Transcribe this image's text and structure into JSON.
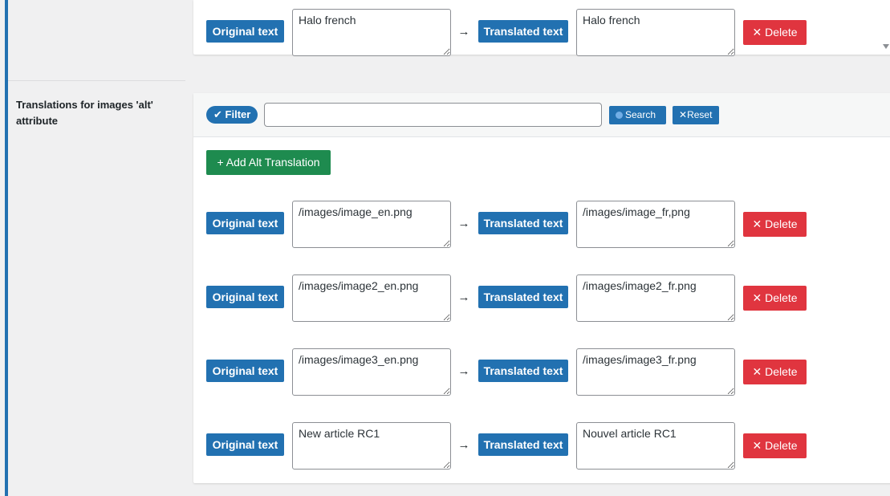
{
  "top_row": {
    "original_label": "Original text",
    "original_value": "Halo french",
    "arrow": "→",
    "translated_label": "Translated text",
    "translated_value": "Halo french",
    "delete_label": "Delete"
  },
  "section": {
    "label": "Translations for images 'alt' attribute"
  },
  "filter_bar": {
    "filter_label": "Filter",
    "filter_icon": "check-icon",
    "search_value": "",
    "search_label": "Search",
    "search_icon": "search-icon",
    "reset_label": "Reset",
    "reset_icon": "close-icon"
  },
  "add_button": {
    "label": "Add Alt Translation",
    "icon": "plus-icon"
  },
  "rows": [
    {
      "original_label": "Original text",
      "original_value": "/images/image_en.png",
      "arrow": "→",
      "translated_label": "Translated text",
      "translated_value": "/images/image_fr,png",
      "delete_label": "Delete"
    },
    {
      "original_label": "Original text",
      "original_value": "/images/image2_en.png",
      "arrow": "→",
      "translated_label": "Translated text",
      "translated_value": "/images/image2_fr.png",
      "delete_label": "Delete"
    },
    {
      "original_label": "Original text",
      "original_value": "/images/image3_en.png",
      "arrow": "→",
      "translated_label": "Translated text",
      "translated_value": "/images/image3_fr.png",
      "delete_label": "Delete"
    },
    {
      "original_label": "Original text",
      "original_value": "New article RC1",
      "arrow": "→",
      "translated_label": "Translated text",
      "translated_value": "Nouvel article RC1",
      "delete_label": "Delete"
    }
  ],
  "colors": {
    "primary": "#2271b1",
    "success": "#1e8b4f",
    "danger": "#e0353f",
    "background": "#f0f0f1"
  }
}
